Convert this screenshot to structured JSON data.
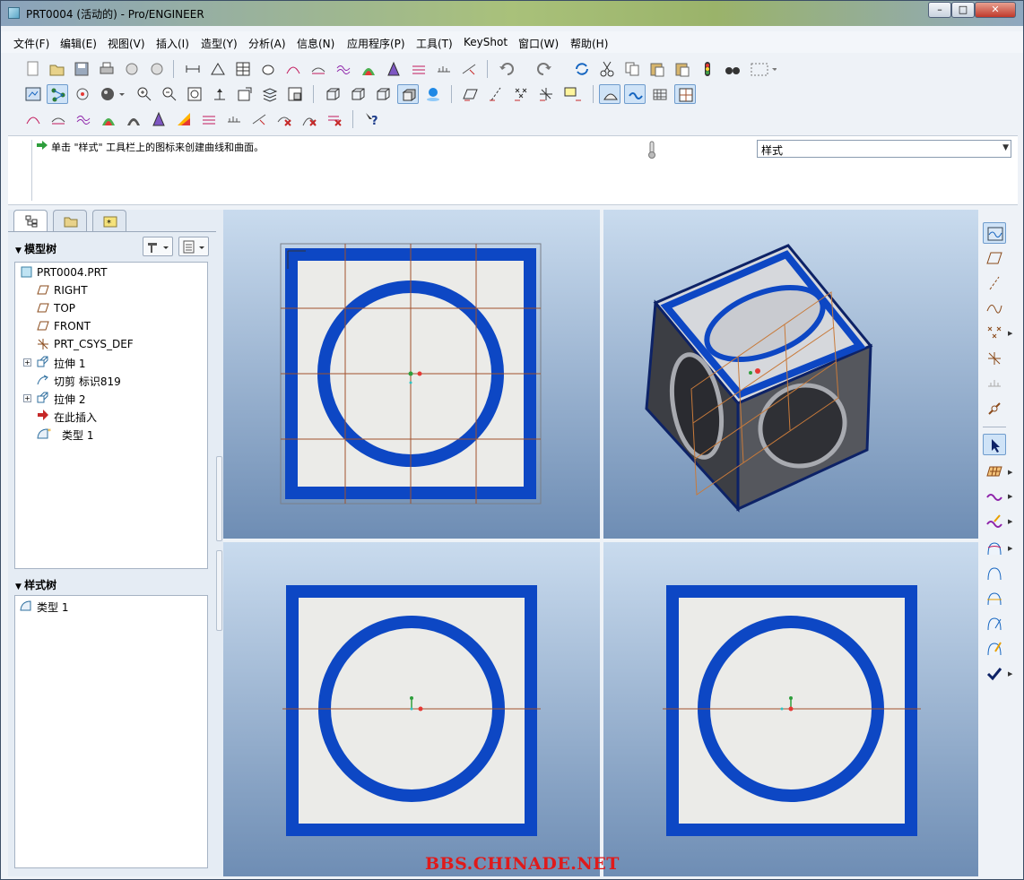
{
  "window": {
    "title": "PRT0004 (活动的) - Pro/ENGINEER",
    "controls": {
      "minimize": "–",
      "maximize": "□",
      "close": "✕"
    }
  },
  "menu": [
    "文件(F)",
    "编辑(E)",
    "视图(V)",
    "插入(I)",
    "造型(Y)",
    "分析(A)",
    "信息(N)",
    "应用程序(P)",
    "工具(T)",
    "KeyShot",
    "窗口(W)",
    "帮助(H)"
  ],
  "message": {
    "text": "单击 \"样式\" 工具栏上的图标来创建曲线和曲面。"
  },
  "style_dropdown": {
    "value": "样式"
  },
  "model_tree": {
    "header": "模型树",
    "items": [
      {
        "label": "PRT0004.PRT",
        "icon": "part-icon"
      },
      {
        "label": "RIGHT",
        "icon": "datum-plane-icon"
      },
      {
        "label": "TOP",
        "icon": "datum-plane-icon"
      },
      {
        "label": "FRONT",
        "icon": "datum-plane-icon"
      },
      {
        "label": "PRT_CSYS_DEF",
        "icon": "csys-icon"
      },
      {
        "label": "拉伸 1",
        "icon": "extrude-icon"
      },
      {
        "label": "切剪 标识819",
        "icon": "cut-icon"
      },
      {
        "label": "拉伸 2",
        "icon": "extrude-icon"
      },
      {
        "label": "在此插入",
        "icon": "insert-here-icon"
      },
      {
        "label": "类型 1",
        "icon": "style-feature-icon"
      }
    ]
  },
  "style_tree": {
    "header": "样式树",
    "items": [
      {
        "label": "类型 1",
        "icon": "style-feature-icon"
      }
    ]
  },
  "watermark": "BBS.CHINADE.NET",
  "colors": {
    "frame_blue": "#0d47c4",
    "face_gray": "#ebebe8",
    "viewport_top": "#c9dbee",
    "viewport_bottom": "#6e8db4",
    "datum_brown": "#a0522d"
  }
}
